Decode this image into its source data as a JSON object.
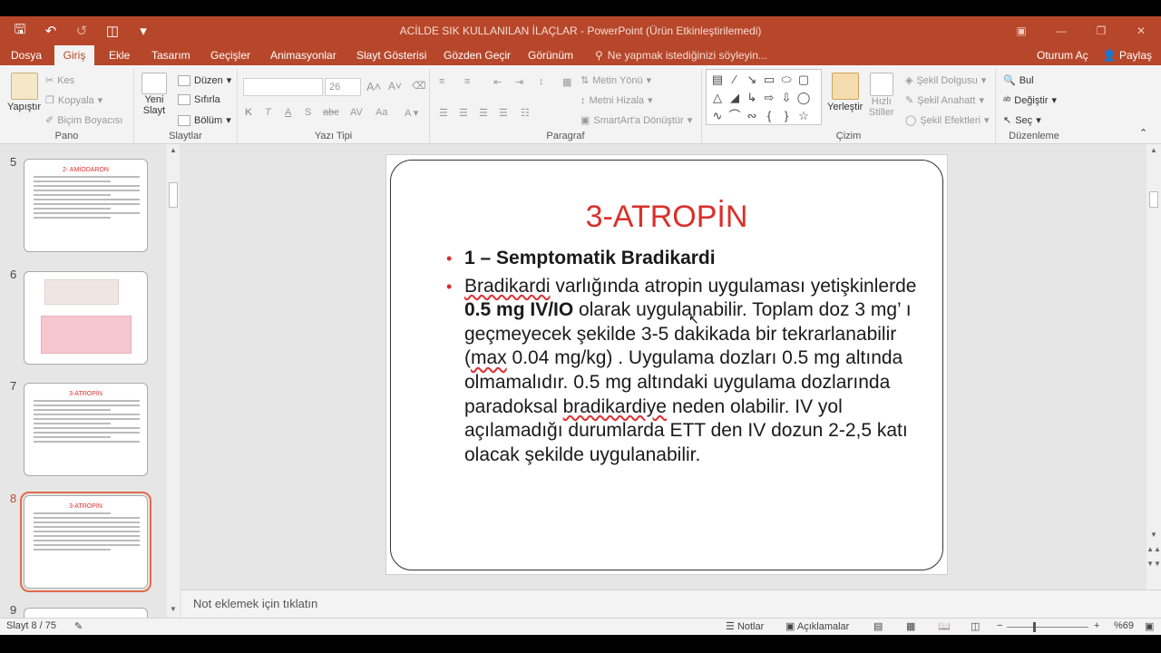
{
  "window": {
    "title": "ACİLDE SIK KULLANILAN İLAÇLAR - PowerPoint (Ürün Etkinleştirilemedi)"
  },
  "tabs": [
    "Dosya",
    "Giriş",
    "Ekle",
    "Tasarım",
    "Geçişler",
    "Animasyonlar",
    "Slayt Gösterisi",
    "Gözden Geçir",
    "Görünüm"
  ],
  "tell_me": "Ne yapmak istediğinizi söyleyin...",
  "account": {
    "signin": "Oturum Aç",
    "share": "Paylaş"
  },
  "ribbon": {
    "pano": {
      "label": "Pano",
      "paste": "Yapıştır",
      "cut": "Kes",
      "copy": "Kopyala",
      "format_painter": "Biçim Boyacısı"
    },
    "slaytlar": {
      "label": "Slaytlar",
      "new_slide_1": "Yeni",
      "new_slide_2": "Slayt",
      "layout": "Düzen",
      "reset": "Sıfırla",
      "section": "Bölüm"
    },
    "yazi_tipi": {
      "label": "Yazı Tipi",
      "font_size": "26"
    },
    "paragraf": {
      "label": "Paragraf",
      "text_direction": "Metin Yönü",
      "align_text": "Metni Hizala",
      "smartart": "SmartArt'a Dönüştür"
    },
    "cizim": {
      "label": "Çizim",
      "arrange": "Yerleştir",
      "quick_styles_1": "Hızlı",
      "quick_styles_2": "Stiller",
      "shape_fill": "Şekil Dolgusu",
      "shape_outline": "Şekil Anahatt",
      "shape_effects": "Şekil Efektleri"
    },
    "duzenleme": {
      "label": "Düzenleme",
      "find": "Bul",
      "replace": "Değiştir",
      "select": "Seç"
    }
  },
  "thumbnails": {
    "numbers": [
      "5",
      "6",
      "7",
      "8",
      "9"
    ],
    "t5_title": "2- AMİODARON",
    "t7_title": "3-ATROPİN",
    "t8_title": "3-ATROPİN"
  },
  "slide": {
    "title": "3-ATROPİN",
    "bullet1": "1 – Semptomatik Bradikardi",
    "b2_word1": "Bradikardi",
    "b2_part1": " varlığında atropin uygulaması yetişkinlerde ",
    "b2_bold": "0.5 mg IV/IO",
    "b2_part2": " olarak uygulanabilir. Toplam doz 3 mg’ ı geçmeyecek şekilde 3-5 dakikada bir tekrarlanabilir (",
    "b2_max": "max",
    "b2_part3": " 0.04 mg/kg) . Uygulama dozları 0.5 mg altında olmamalıdır. 0.5 mg altındaki uygulama dozlarında paradoksal ",
    "b2_brady": "bradikardiye",
    "b2_part4": " neden olabilir. IV yol açılamadığı durumlarda ETT den IV dozun 2-2,5 katı olacak şekilde uygulanabilir."
  },
  "notes_placeholder": "Not eklemek için tıklatın",
  "status": {
    "slide_count": "Slayt 8 / 75",
    "notes": "Notlar",
    "comments": "Açıklamalar",
    "zoom": "%69"
  }
}
